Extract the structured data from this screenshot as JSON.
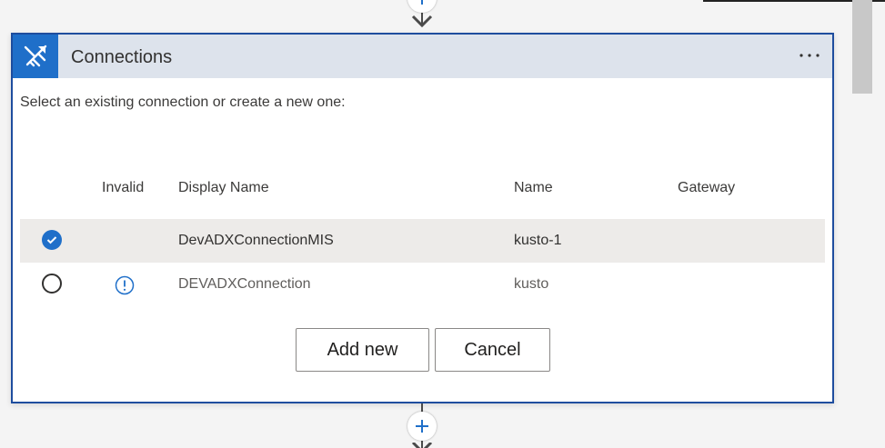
{
  "card": {
    "title": "Connections",
    "instructions": "Select an existing connection or create a new one:",
    "more_label": "···"
  },
  "table": {
    "headers": {
      "invalid": "Invalid",
      "display_name": "Display Name",
      "name": "Name",
      "gateway": "Gateway"
    },
    "rows": [
      {
        "selected": true,
        "invalid": false,
        "display_name": "DevADXConnectionMIS",
        "name": "kusto-1",
        "gateway": ""
      },
      {
        "selected": false,
        "invalid": true,
        "display_name": "DEVADXConnection",
        "name": "kusto",
        "gateway": ""
      }
    ]
  },
  "actions": {
    "add_new_label": "Add new",
    "cancel_label": "Cancel"
  },
  "icons": {
    "app": "azure-data-explorer-icon",
    "more": "ellipsis-icon",
    "check": "checkmark-icon",
    "warning": "exclamation-circle-icon",
    "plus": "plus-icon",
    "arrow": "arrow-down-icon"
  },
  "colors": {
    "accent": "#1f6fc9",
    "card_border": "#1e4d9e",
    "header_bg": "#dde3ec",
    "selected_row": "#edebe9"
  }
}
